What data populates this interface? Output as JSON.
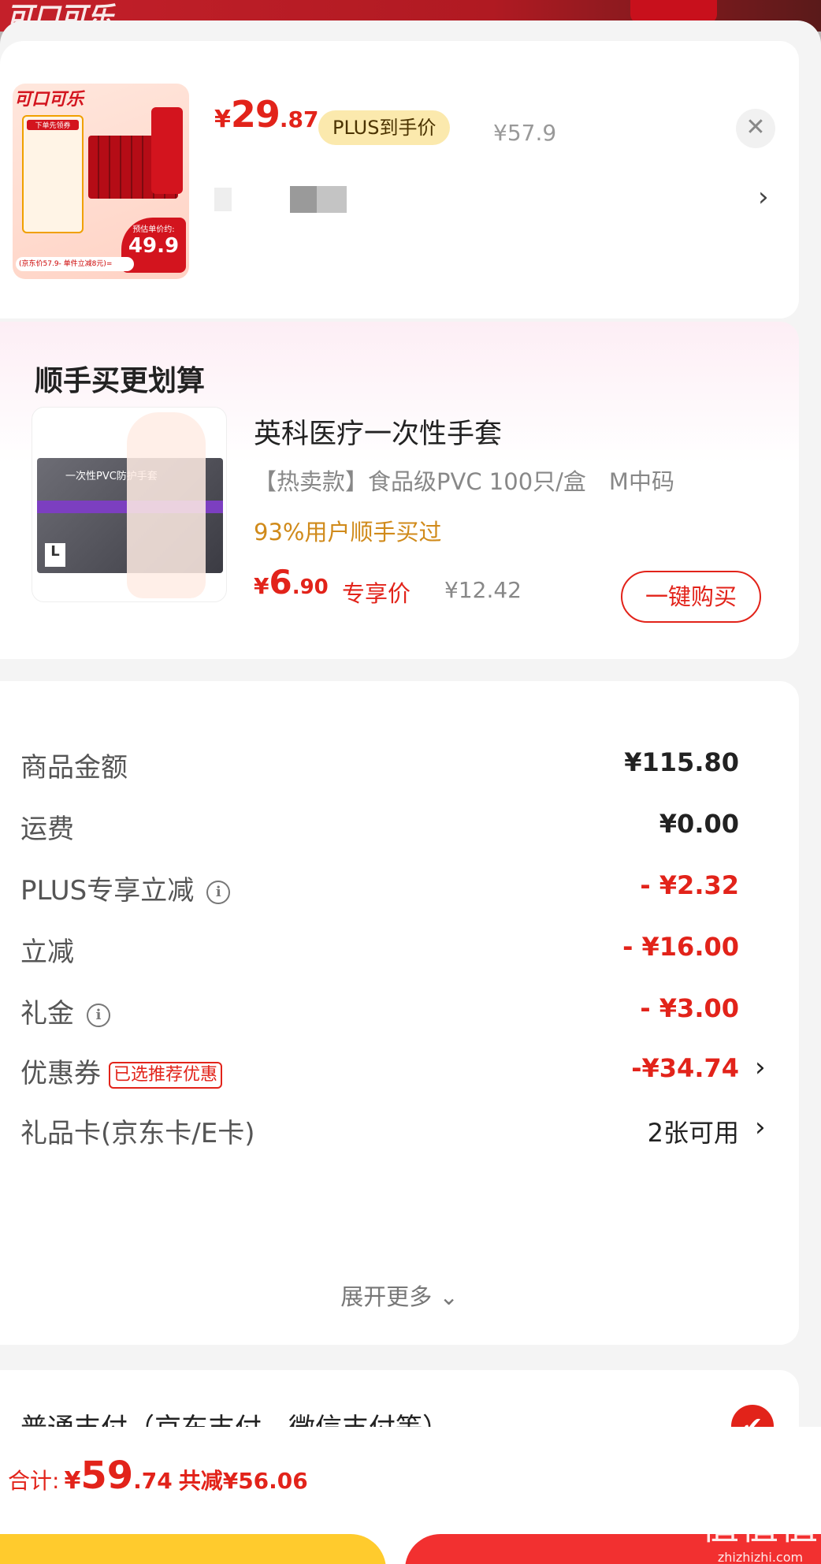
{
  "product": {
    "image_brand": "可口可乐",
    "image_promo": "下单先领券",
    "image_est_label": "预估单价约:",
    "image_est_value": "49.9",
    "image_strip": "(京东价57.9- 单件立减8元)=",
    "price_currency": "¥",
    "price_int": "29",
    "price_dec": ".87",
    "plus_tag": "PLUS到手价",
    "original_price": "¥57.9",
    "close_icon_glyph": "✕",
    "spec_arrow_glyph": "›"
  },
  "upsell": {
    "section_title": "顺手买更划算",
    "name": "英科医疗一次性手套",
    "spec": "【热卖款】食品级PVC 100只/盒　M中码",
    "social_proof": "93%用户顺手买过",
    "price_currency": "¥",
    "price_int": "6",
    "price_dec": ".90",
    "price_tag": "专享价",
    "original_price": "¥12.42",
    "buy_button": "一键购买",
    "image_label": "一次性PVC防护手套",
    "image_size": "L"
  },
  "details": {
    "rows": [
      {
        "label": "商品金额",
        "value": "¥115.80"
      },
      {
        "label": "运费",
        "value": "¥0.00"
      },
      {
        "label": "PLUS专享立减",
        "value": "- ¥2.32"
      },
      {
        "label": "立减",
        "value": "- ¥16.00"
      },
      {
        "label": "礼金",
        "value": "- ¥3.00"
      },
      {
        "label": "优惠券",
        "badge": "已选推荐优惠",
        "value": "-¥34.74"
      },
      {
        "label": "礼品卡(京东卡/E卡)",
        "value": "2张可用"
      }
    ],
    "expand": "展开更多 ⌄",
    "info_glyph": "i",
    "chevron_glyph": "›"
  },
  "payment": {
    "method": "普通支付（京东支付、微信支付等）",
    "check_glyph": "✔"
  },
  "summary": {
    "label": "合计:",
    "currency": "¥",
    "int": "59",
    "dec": ".74",
    "saved": "共减¥56.06"
  },
  "watermark": {
    "big": "值值值",
    "small": "zhizhizhi.com"
  },
  "colors": {
    "accent_red": "#e2231a",
    "plus_gold": "#fbe9ad",
    "social_orange": "#d08a1a",
    "button_yellow": "#ffcb2d"
  }
}
